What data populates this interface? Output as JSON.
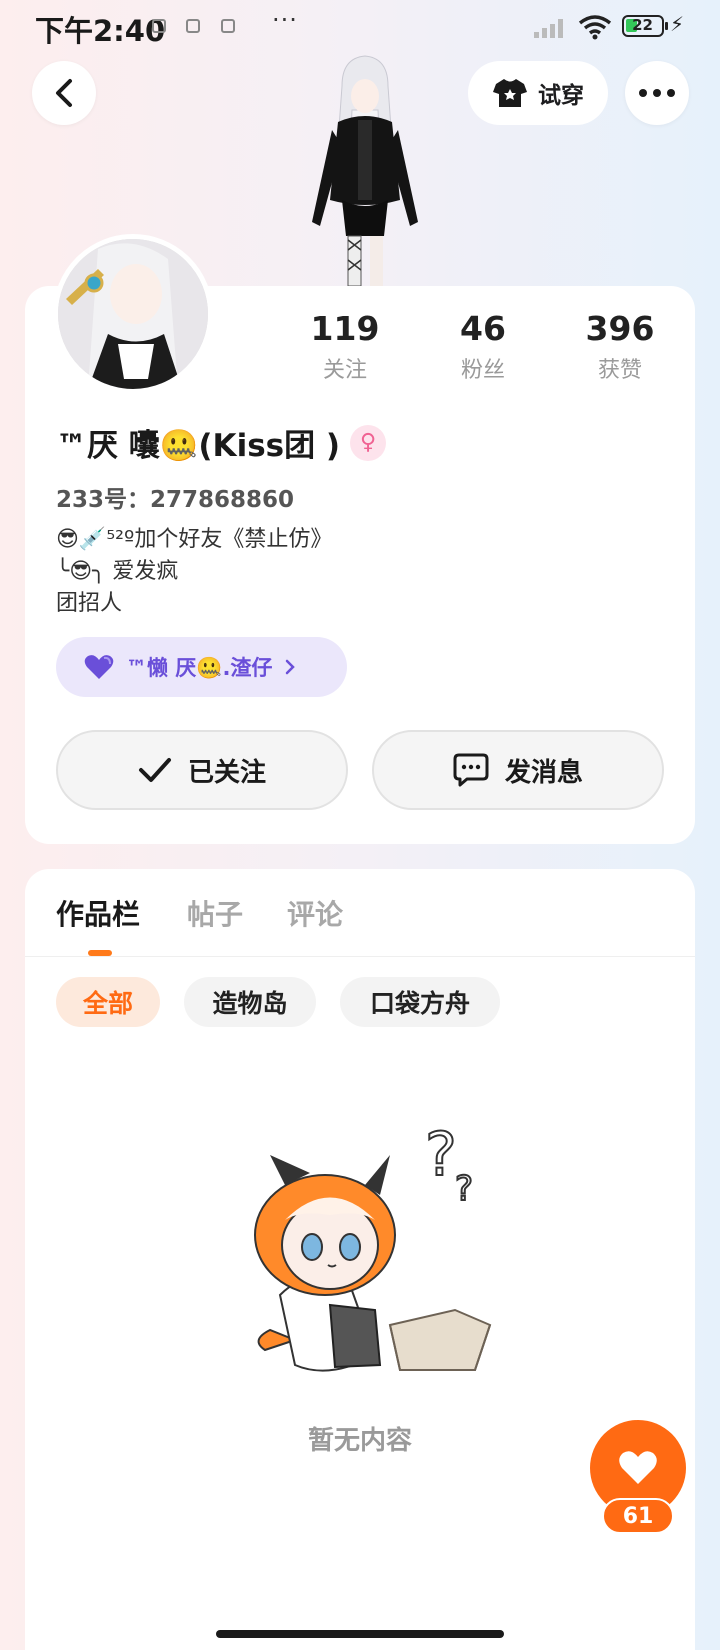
{
  "status_bar": {
    "time": "下午2:40",
    "dots": "···",
    "battery": "22"
  },
  "header": {
    "try_on_label": "试穿"
  },
  "profile": {
    "stats": [
      {
        "value": "119",
        "label": "关注"
      },
      {
        "value": "46",
        "label": "粉丝"
      },
      {
        "value": "396",
        "label": "获赞"
      }
    ],
    "nickname": "™厌 囔🤐(Kiss团 )",
    "gender_symbol": "♀",
    "uid": "233号：277868860",
    "bio": "😎💉⁵²º加个好友《禁止仿》\n╰😎╮ 爱发疯\n团招人",
    "group_name": "™懒 厌🤐.渣仔",
    "follow_label": "已关注",
    "message_label": "发消息"
  },
  "works": {
    "tabs": [
      "作品栏",
      "帖子",
      "评论"
    ],
    "filters": [
      "全部",
      "造物岛",
      "口袋方舟"
    ],
    "empty_text": "暂无内容"
  },
  "like": {
    "count": "61"
  },
  "colors": {
    "accent": "#ff6a13",
    "group_pill_bg": "#ebe7fb",
    "group_pill_text": "#6a4fd9"
  },
  "icons": [
    "back-arrow-icon",
    "shirt-icon",
    "more-icon",
    "female-icon",
    "heart-icon",
    "chevron-right-icon",
    "check-icon",
    "chat-icon",
    "heart-like-icon"
  ]
}
